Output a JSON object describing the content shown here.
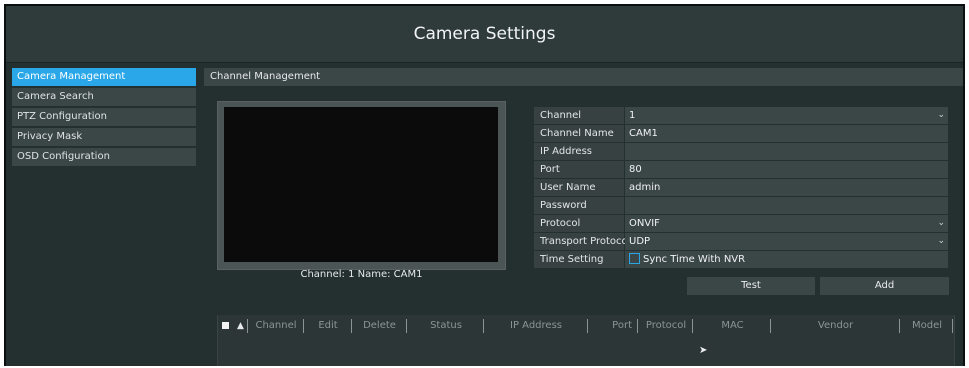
{
  "window": {
    "title": "Camera Settings"
  },
  "sidebar": {
    "items": [
      {
        "label": "Camera Management",
        "active": true
      },
      {
        "label": "Camera Search",
        "active": false
      },
      {
        "label": "PTZ Configuration",
        "active": false
      },
      {
        "label": "Privacy Mask",
        "active": false
      },
      {
        "label": "OSD Configuration",
        "active": false
      }
    ]
  },
  "panel": {
    "title": "Channel Management"
  },
  "preview": {
    "caption": "Channel: 1 Name: CAM1"
  },
  "form": {
    "channel": {
      "label": "Channel",
      "value": "1"
    },
    "channel_name": {
      "label": "Channel Name",
      "value": "CAM1"
    },
    "ip_address": {
      "label": "IP Address",
      "value": ""
    },
    "port": {
      "label": "Port",
      "value": "80"
    },
    "user_name": {
      "label": "User Name",
      "value": "admin"
    },
    "password": {
      "label": "Password",
      "value": ""
    },
    "protocol": {
      "label": "Protocol",
      "value": "ONVIF"
    },
    "transport_protocol": {
      "label": "Transport Protocol",
      "value": "UDP"
    },
    "time_setting": {
      "label": "Time Setting",
      "value": "Sync Time With NVR",
      "checked": false
    }
  },
  "buttons": {
    "test": "Test",
    "add": "Add"
  },
  "table": {
    "sort_indicator": "▲",
    "columns": [
      "Channel",
      "Edit",
      "Delete",
      "Status",
      "IP Address",
      "Port",
      "Protocol",
      "MAC",
      "Vendor",
      "Model"
    ],
    "rows": []
  },
  "colors": {
    "accent": "#2aa7e8",
    "background": "#243030",
    "panel": "#3b4647"
  }
}
